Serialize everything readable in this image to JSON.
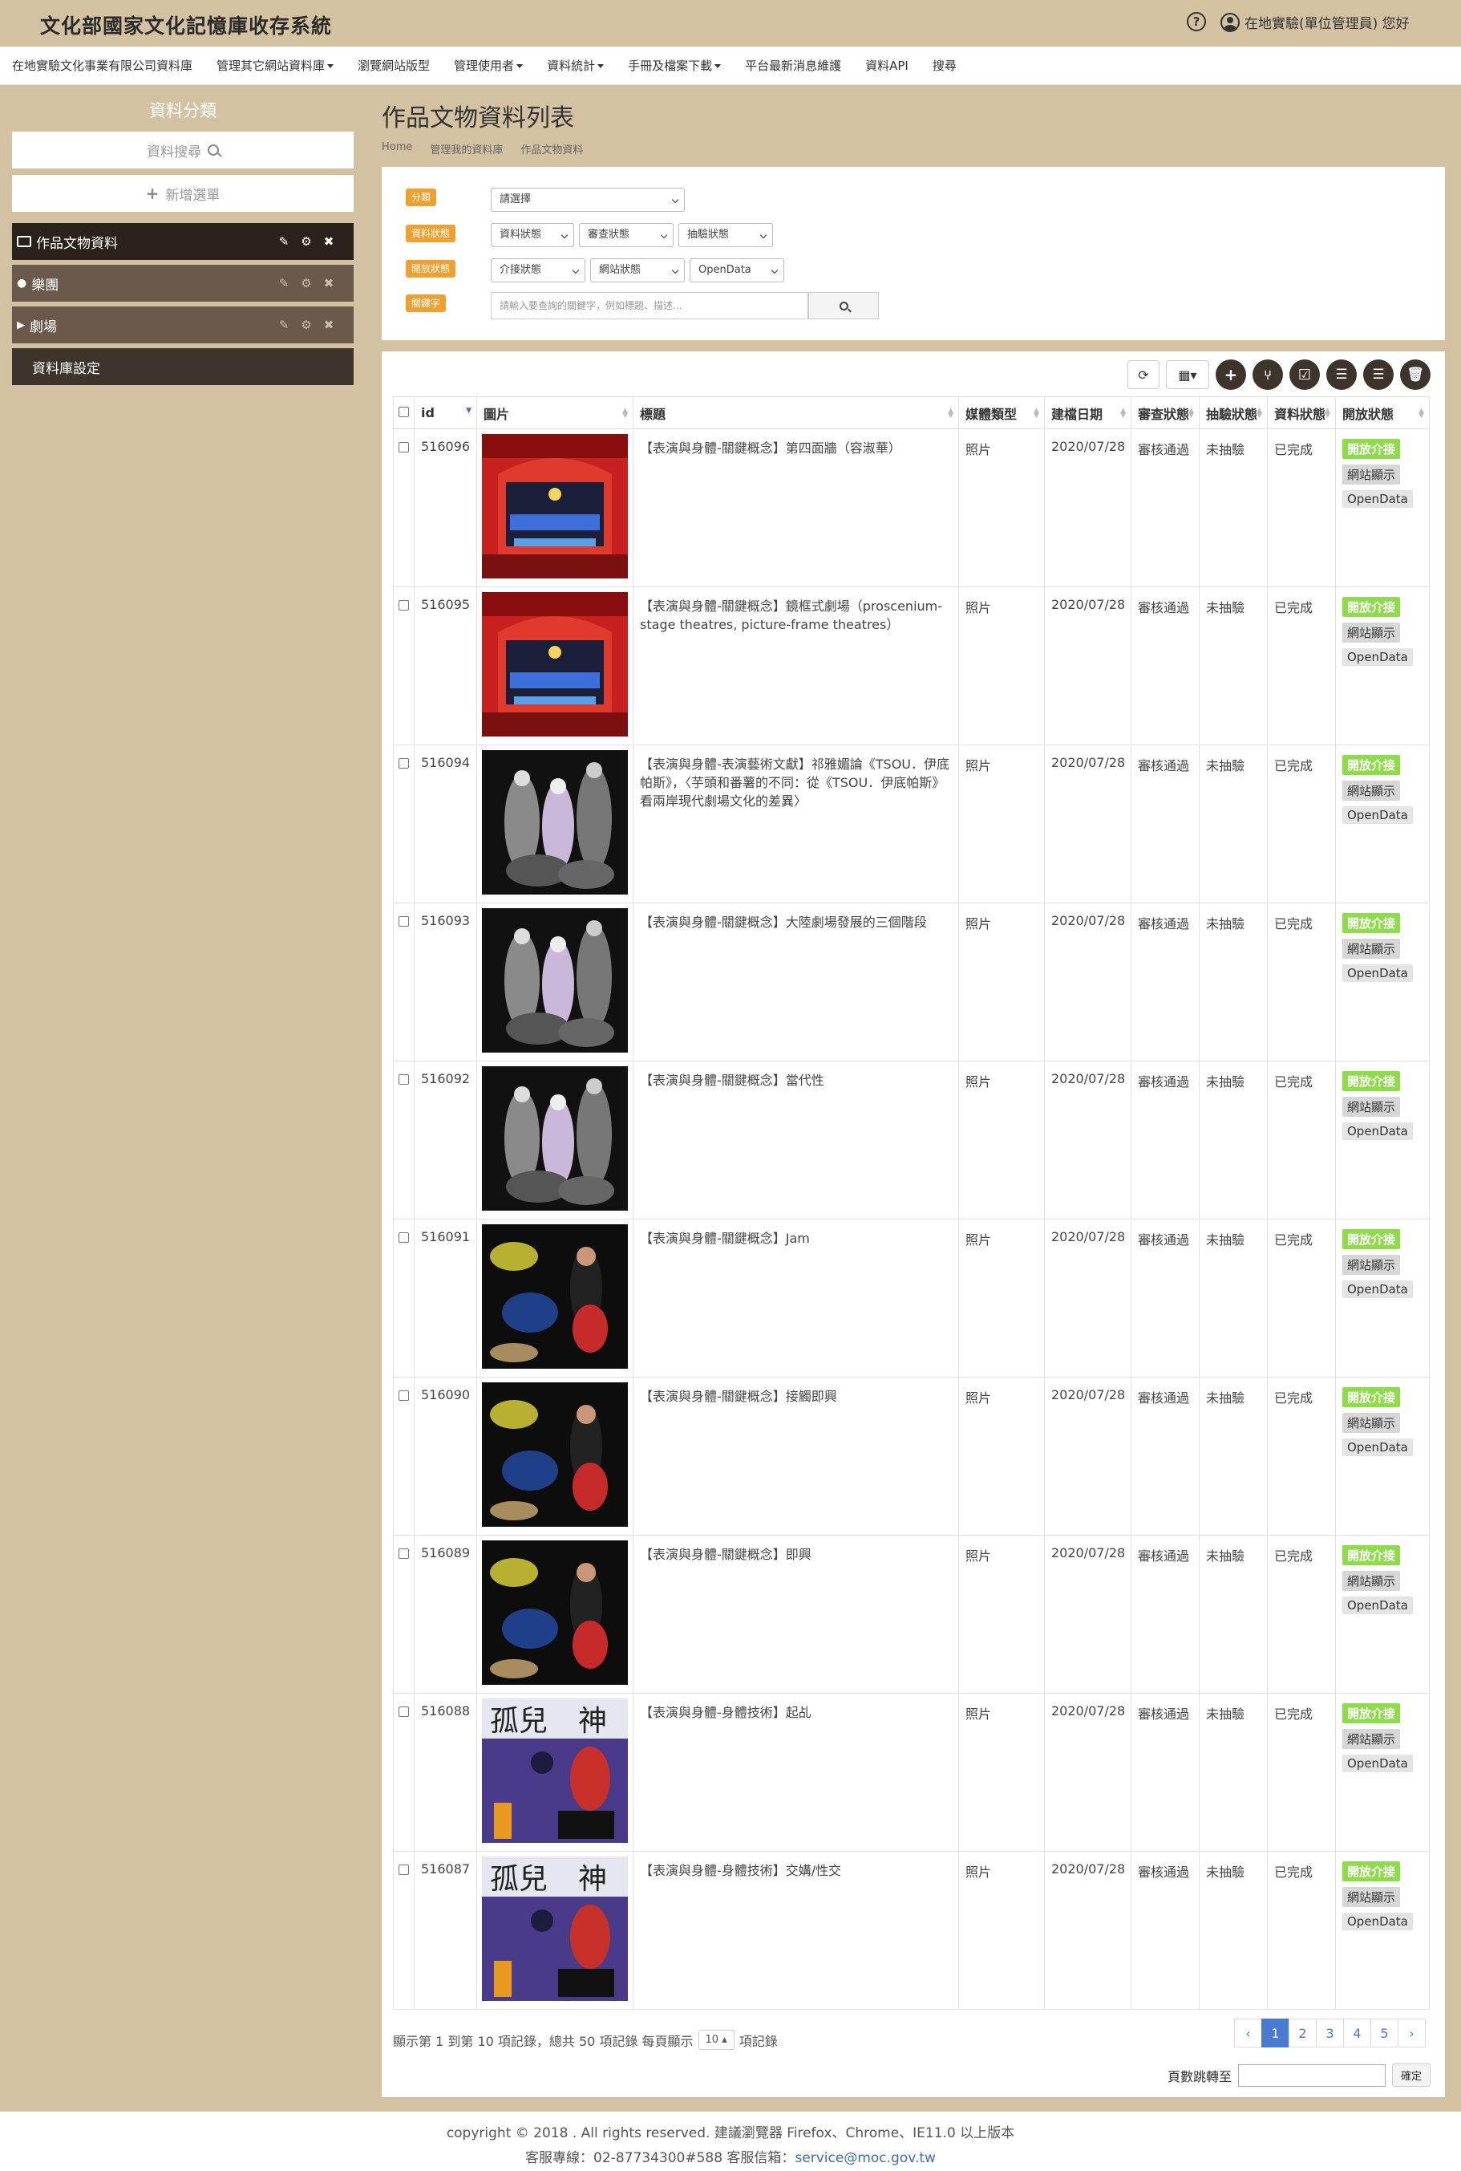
{
  "app": {
    "title": "文化部國家文化記憶庫收存系統",
    "help_icon": "question-circle-icon",
    "user_text": "在地實驗(單位管理員) 您好"
  },
  "nav": {
    "items": [
      {
        "label": "在地實驗文化事業有限公司資料庫",
        "dropdown": false
      },
      {
        "label": "管理其它網站資料庫",
        "dropdown": true
      },
      {
        "label": "瀏覽網站版型",
        "dropdown": false
      },
      {
        "label": "管理使用者",
        "dropdown": true
      },
      {
        "label": "資料統計",
        "dropdown": true
      },
      {
        "label": "手冊及檔案下載",
        "dropdown": true
      },
      {
        "label": "平台最新消息維護",
        "dropdown": false
      },
      {
        "label": "資料API",
        "dropdown": false
      },
      {
        "label": "搜尋",
        "dropdown": false
      }
    ]
  },
  "sidebar": {
    "heading": "資料分類",
    "search_label": "資料搜尋",
    "add_label": "新增選單",
    "categories": [
      {
        "label": "作品文物資料",
        "icon": "image-icon",
        "active": true
      },
      {
        "label": "樂團",
        "icon": "user-icon",
        "active": false
      },
      {
        "label": "劇場",
        "icon": "video-icon",
        "active": false
      }
    ],
    "db_setting_label": "資料庫設定"
  },
  "main": {
    "title": "作品文物資料列表",
    "breadcrumb": [
      "Home",
      "管理我的資料庫",
      "作品文物資料"
    ]
  },
  "filters": {
    "labels": [
      "分類",
      "資料狀態",
      "開放狀態",
      "關鍵字"
    ],
    "category_select": "請選擇",
    "data_status_selects": [
      "資料狀態",
      "審查狀態",
      "抽驗狀態"
    ],
    "open_status_selects": [
      "介接狀態",
      "網站狀態",
      "OpenData"
    ],
    "keyword_placeholder": "請輸入要查詢的關鍵字，例如標題、描述..."
  },
  "table": {
    "columns": [
      "id",
      "圖片",
      "標題",
      "媒體類型",
      "建檔日期",
      "審查狀態",
      "抽驗狀態",
      "資料狀態",
      "開放狀態"
    ],
    "tag_labels": [
      "開放介接",
      "網站顯示",
      "OpenData"
    ],
    "rows": [
      {
        "id": "516096",
        "image": "theatre-stage",
        "title": "【表演與身體-關鍵概念】第四面牆（容淑華）",
        "media": "照片",
        "date": "2020/07/28",
        "review": "審核通過",
        "sample": "未抽驗",
        "status": "已完成"
      },
      {
        "id": "516095",
        "image": "theatre-stage",
        "title": "【表演與身體-關鍵概念】鏡框式劇場（proscenium-stage theatres, picture-frame theatres）",
        "media": "照片",
        "date": "2020/07/28",
        "review": "審核通過",
        "sample": "未抽驗",
        "status": "已完成"
      },
      {
        "id": "516094",
        "image": "dance-group",
        "title": "【表演與身體-表演藝術文獻】祁雅媚論《TSOU．伊底帕斯》，〈芋頭和番薯的不同：從《TSOU．伊底帕斯》看兩岸現代劇場文化的差異〉",
        "media": "照片",
        "date": "2020/07/28",
        "review": "審核通過",
        "sample": "未抽驗",
        "status": "已完成"
      },
      {
        "id": "516093",
        "image": "dance-group",
        "title": "【表演與身體-關鍵概念】大陸劇場發展的三個階段",
        "media": "照片",
        "date": "2020/07/28",
        "review": "審核通過",
        "sample": "未抽驗",
        "status": "已完成"
      },
      {
        "id": "516092",
        "image": "dance-group",
        "title": "【表演與身體-關鍵概念】當代性",
        "media": "照片",
        "date": "2020/07/28",
        "review": "審核通過",
        "sample": "未抽驗",
        "status": "已完成"
      },
      {
        "id": "516091",
        "image": "dancers-dark",
        "title": "【表演與身體-關鍵概念】Jam",
        "media": "照片",
        "date": "2020/07/28",
        "review": "審核通過",
        "sample": "未抽驗",
        "status": "已完成"
      },
      {
        "id": "516090",
        "image": "dancers-dark",
        "title": "【表演與身體-關鍵概念】接觸即興",
        "media": "照片",
        "date": "2020/07/28",
        "review": "審核通過",
        "sample": "未抽驗",
        "status": "已完成"
      },
      {
        "id": "516089",
        "image": "dancers-dark",
        "title": "【表演與身體-關鍵概念】即興",
        "media": "照片",
        "date": "2020/07/28",
        "review": "審核通過",
        "sample": "未抽驗",
        "status": "已完成"
      },
      {
        "id": "516088",
        "image": "book-cover",
        "title": "【表演與身體-身體技術】起乩",
        "media": "照片",
        "date": "2020/07/28",
        "review": "審核通過",
        "sample": "未抽驗",
        "status": "已完成"
      },
      {
        "id": "516087",
        "image": "book-cover",
        "title": "【表演與身體-身體技術】交媾/性交",
        "media": "照片",
        "date": "2020/07/28",
        "review": "審核通過",
        "sample": "未抽驗",
        "status": "已完成"
      }
    ]
  },
  "pagination": {
    "summary_prefix": "顯示第 1 到第 10 項記錄，總共 50 項記錄 每頁顯示",
    "per_page": "10",
    "summary_suffix": "項記錄",
    "prev": "‹",
    "pages": [
      "1",
      "2",
      "3",
      "4",
      "5"
    ],
    "next": "›",
    "current_page": "1",
    "jump_label": "頁數跳轉至",
    "jump_button": "確定"
  },
  "footer": {
    "line1": "copyright © 2018 . All rights reserved. 建議瀏覽器 Firefox、Chrome、IE11.0 以上版本",
    "line2_prefix": "客服專線：02-87734300#588  客服信箱：",
    "email": "service@moc.gov.tw"
  }
}
